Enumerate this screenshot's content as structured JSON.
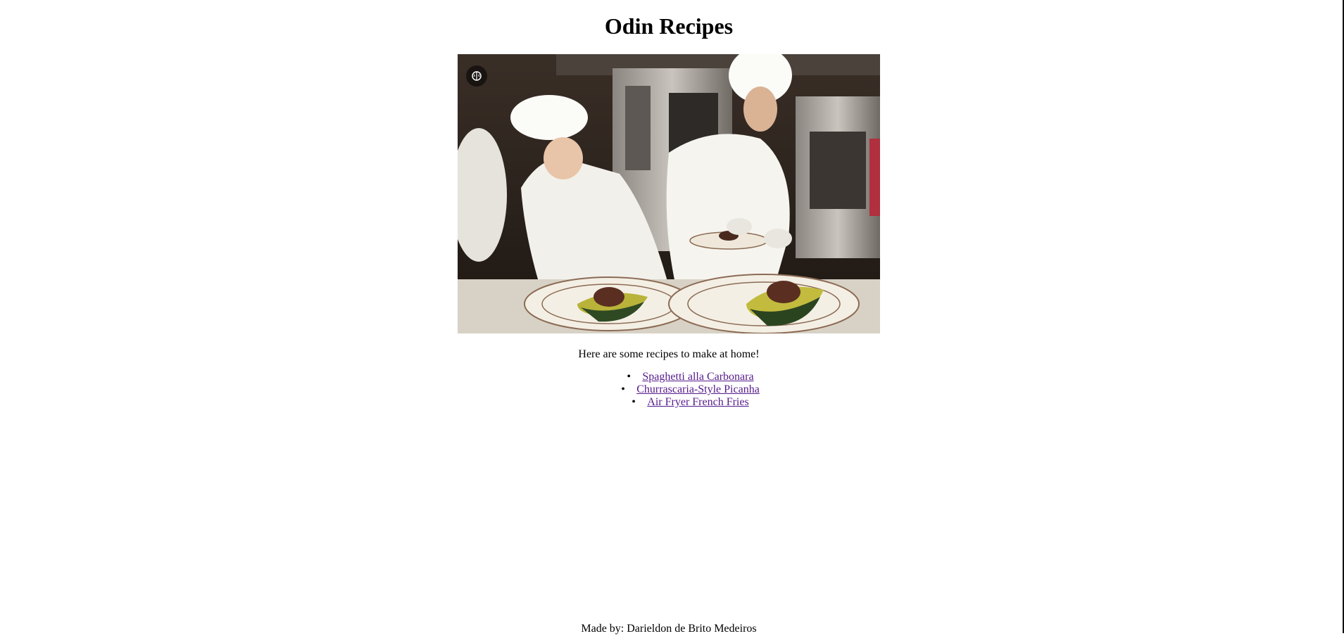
{
  "page": {
    "title": "Odin Recipes"
  },
  "hero": {
    "alt": "Chefs plating dishes in a kitchen",
    "badge_icon": "brain-icon"
  },
  "intro": "Here are some recipes to make at home!",
  "recipes": [
    {
      "label": "Spaghetti alla Carbonara"
    },
    {
      "label": "Churrascaria-Style Picanha"
    },
    {
      "label": "Air Fryer French Fries"
    }
  ],
  "footer": {
    "credit": "Made by: Darieldon de Brito Medeiros"
  },
  "colors": {
    "link_visited": "#551a8b",
    "text": "#000000",
    "background": "#ffffff"
  }
}
